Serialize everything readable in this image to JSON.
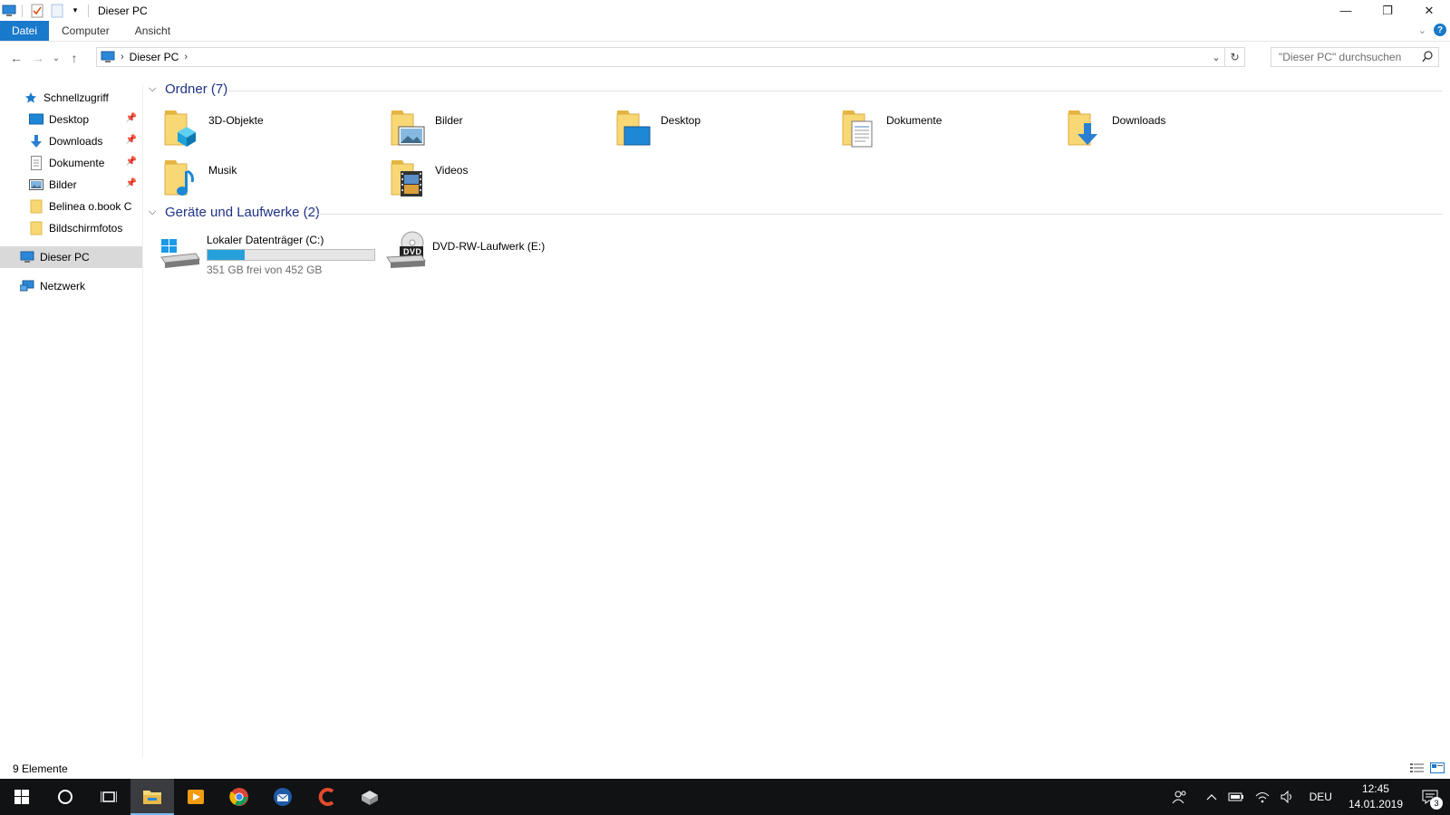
{
  "window": {
    "title": "Dieser PC",
    "minimize_symbol": "—",
    "restore_symbol": "❐",
    "close_symbol": "✕"
  },
  "ribbon": {
    "tabs": [
      {
        "label": "Datei",
        "active": true
      },
      {
        "label": "Computer",
        "active": false
      },
      {
        "label": "Ansicht",
        "active": false
      }
    ]
  },
  "address": {
    "crumbs": [
      "Dieser PC"
    ],
    "search_placeholder": "\"Dieser PC\" durchsuchen"
  },
  "sidebar": {
    "quick_access_label": "Schnellzugriff",
    "quick_items": [
      {
        "label": "Desktop",
        "icon": "desktop-icon",
        "pinned": true
      },
      {
        "label": "Downloads",
        "icon": "download-icon",
        "pinned": true
      },
      {
        "label": "Dokumente",
        "icon": "document-icon",
        "pinned": true
      },
      {
        "label": "Bilder",
        "icon": "pictures-icon",
        "pinned": true
      },
      {
        "label": "Belinea o.book C",
        "icon": "folder-icon",
        "pinned": false
      },
      {
        "label": "Bildschirmfotos",
        "icon": "folder-icon",
        "pinned": false
      }
    ],
    "this_pc_label": "Dieser PC",
    "network_label": "Netzwerk"
  },
  "content": {
    "folders_header": "Ordner (7)",
    "folders": [
      {
        "label": "3D-Objekte",
        "icon": "3d-objects-folder-icon"
      },
      {
        "label": "Bilder",
        "icon": "pictures-folder-icon"
      },
      {
        "label": "Desktop",
        "icon": "desktop-folder-icon"
      },
      {
        "label": "Dokumente",
        "icon": "documents-folder-icon"
      },
      {
        "label": "Downloads",
        "icon": "downloads-folder-icon"
      },
      {
        "label": "Musik",
        "icon": "music-folder-icon"
      },
      {
        "label": "Videos",
        "icon": "videos-folder-icon"
      }
    ],
    "drives_header": "Geräte und Laufwerke (2)",
    "drives": [
      {
        "label": "Lokaler Datenträger (C:)",
        "free_text": "351 GB frei von 452 GB",
        "used_fraction": 0.223,
        "icon": "windows-drive-icon"
      },
      {
        "label": "DVD-RW-Laufwerk (E:)",
        "icon": "dvd-drive-icon",
        "badge": "DVD"
      }
    ]
  },
  "status": {
    "item_count": "9 Elemente"
  },
  "taskbar": {
    "apps": [
      "start-icon",
      "cortana-icon",
      "task-view-icon",
      "file-explorer-icon",
      "media-player-icon",
      "chrome-icon",
      "thunderbird-icon",
      "ccleaner-icon",
      "installer-icon"
    ],
    "language": "DEU",
    "time": "12:45",
    "date": "14.01.2019",
    "notification_count": "3"
  },
  "colors": {
    "accent": "#1979ca",
    "group_header": "#1e3287",
    "drive_fill": "#26a0da",
    "taskbar": "#101214"
  }
}
